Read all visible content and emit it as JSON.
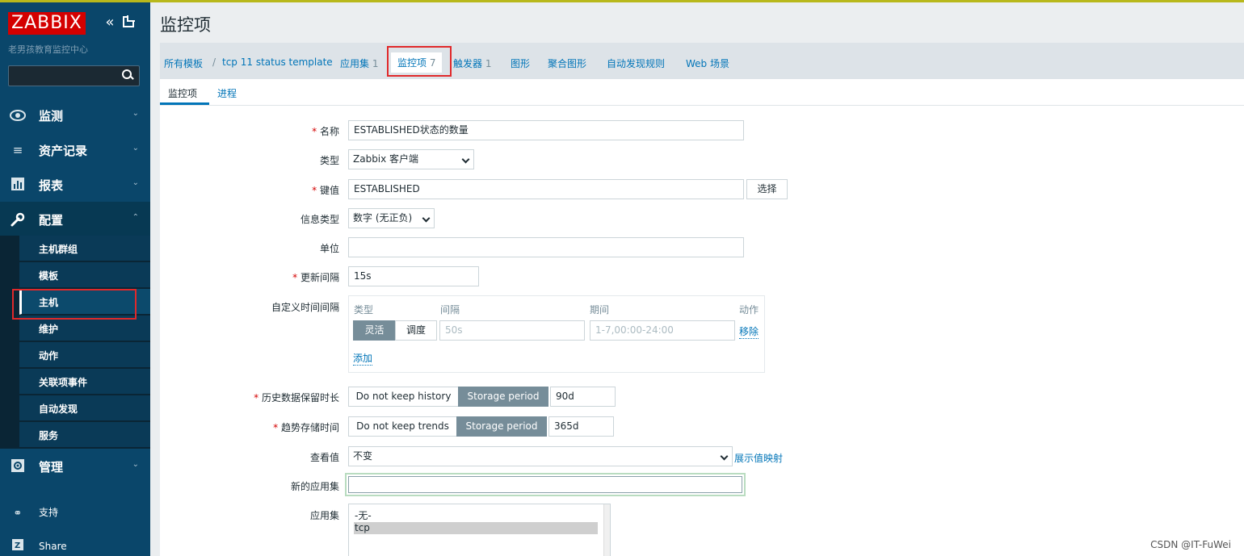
{
  "app": {
    "logo": "ZABBIX",
    "server_name": "老男孩教育监控中心",
    "page_title": "监控项"
  },
  "sidebar": {
    "main": [
      {
        "label": "监测",
        "icon": "eye-icon"
      },
      {
        "label": "资产记录",
        "icon": "list-icon"
      },
      {
        "label": "报表",
        "icon": "bar-chart-icon"
      },
      {
        "label": "配置",
        "icon": "wrench-icon"
      },
      {
        "label": "管理",
        "icon": "gear-icon"
      }
    ],
    "sub": [
      {
        "label": "主机群组"
      },
      {
        "label": "模板"
      },
      {
        "label": "主机"
      },
      {
        "label": "维护"
      },
      {
        "label": "动作"
      },
      {
        "label": "关联项事件"
      },
      {
        "label": "自动发现"
      },
      {
        "label": "服务"
      }
    ],
    "support": "支持",
    "share": "Share",
    "highlight_color": "#e0292b"
  },
  "breadcrumbs": {
    "all_templates": "所有模板",
    "sep": "/",
    "template": "tcp 11 status template",
    "applications": "应用集",
    "applications_count": "1",
    "items": "监控项",
    "items_count": "7",
    "triggers": "触发器",
    "triggers_count": "1",
    "graphs": "图形",
    "screens": "聚合图形",
    "discovery": "自动发现规则",
    "web": "Web 场景"
  },
  "tabs": [
    {
      "label": "监控项"
    },
    {
      "label": "进程"
    }
  ],
  "form": {
    "name_label": "名称",
    "name_value": "ESTABLISHED状态的数量",
    "type_label": "类型",
    "type_value": "Zabbix 客户端",
    "key_label": "键值",
    "key_value": "ESTABLISHED",
    "key_select_btn": "选择",
    "info_type_label": "信息类型",
    "info_type_value": "数字 (无正负)",
    "units_label": "单位",
    "units_value": "",
    "interval_label": "更新间隔",
    "interval_value": "15s",
    "custom_label": "自定义时间间隔",
    "custom": {
      "col_type": "类型",
      "col_interval": "间隔",
      "col_period": "期间",
      "col_action": "动作",
      "flexible": "灵活",
      "scheduling": "调度",
      "interval_placeholder": "50s",
      "period_placeholder": "1-7,00:00-24:00",
      "remove": "移除",
      "add": "添加"
    },
    "history_label": "历史数据保留时长",
    "history_no": "Do not keep history",
    "history_storage": "Storage period",
    "history_value": "90d",
    "trends_label": "趋势存储时间",
    "trends_no": "Do not keep trends",
    "trends_storage": "Storage period",
    "trends_value": "365d",
    "valuemap_label": "查看值",
    "valuemap_value": "不变",
    "valuemap_link": "展示值映射",
    "new_app_label": "新的应用集",
    "new_app_value": "",
    "apps_label": "应用集",
    "apps_options": [
      "-无-",
      "tcp"
    ]
  },
  "watermark": "CSDN @IT-FuWei"
}
